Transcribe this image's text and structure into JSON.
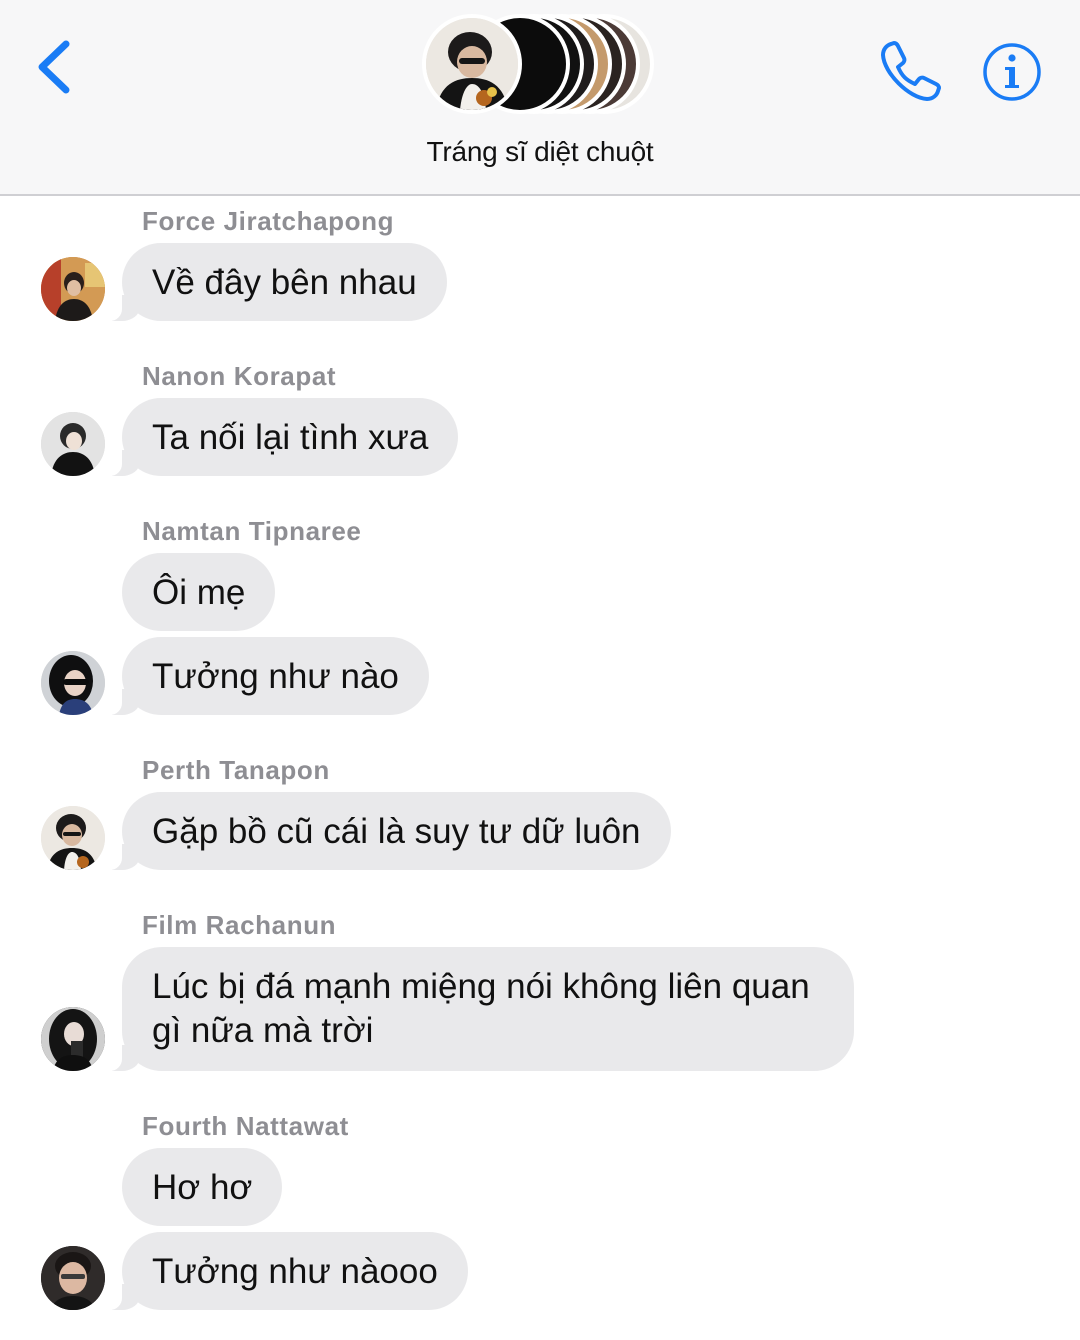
{
  "header": {
    "back_icon": "chevron-left-icon",
    "call_icon": "phone-icon",
    "info_icon": "info-circle-icon",
    "title": "Tráng sĩ diệt chuột",
    "accent_color": "#1a7cf5"
  },
  "messages": [
    {
      "sender": "Force Jiratchapong",
      "bubbles": [
        "Về đây bên nhau"
      ]
    },
    {
      "sender": "Nanon Korapat",
      "bubbles": [
        "Ta nối lại tình xưa"
      ]
    },
    {
      "sender": "Namtan Tipnaree",
      "bubbles": [
        "Ôi mẹ",
        "Tưởng như nào"
      ]
    },
    {
      "sender": "Perth Tanapon",
      "bubbles": [
        "Gặp bồ cũ cái là suy tư dữ luôn"
      ]
    },
    {
      "sender": "Film Rachanun",
      "bubbles": [
        "Lúc bị đá mạnh miệng nói không liên quan gì nữa mà trời"
      ]
    },
    {
      "sender": "Fourth Nattawat",
      "bubbles": [
        "Hơ hơ",
        "Tưởng như nàooo"
      ]
    }
  ],
  "colors": {
    "header_bg": "#f7f7f8",
    "bubble_bg": "#e9e9eb",
    "sender_text": "#8e8e93",
    "message_text": "#111111"
  }
}
